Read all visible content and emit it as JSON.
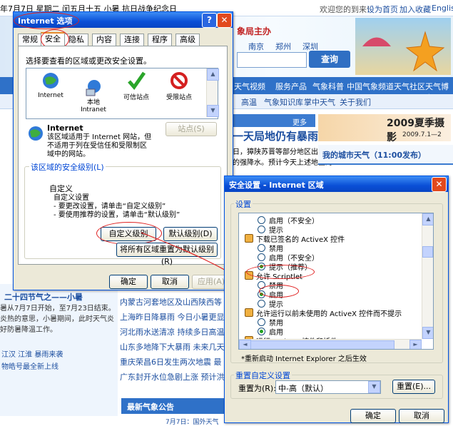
{
  "web": {
    "date_text": "年7月7日 星期二 闰五月十五 小暑 抗日战争纪念日",
    "welcome": "欢迎您的到来!",
    "set_home": "设为首页",
    "add_fav": "加入收藏",
    "english": "English",
    "header_title": "象局主办",
    "cities": [
      "南京",
      "郑州",
      "深圳"
    ],
    "search_btn": "查询",
    "nav": [
      "天气视频",
      "服务产品",
      "气象科普",
      "中国气象频道",
      "天气社区",
      "天气博客"
    ],
    "subnav": [
      "高温",
      "气象知识库",
      "掌中天气",
      "关于我们"
    ],
    "more": "更多",
    "headline": "一天局地仍有暴雨",
    "news_lines": [
      "日，獐陕苏晋等部分地区出",
      "的强降水。预计今天上述地区的"
    ],
    "my_city": "我的城市天气（11:00发布）",
    "banner_text": "2009夏季摄影",
    "banner_date": "2009.7.1—2",
    "left_title": "二十四节气之——小暑",
    "left_lines": [
      "暑从7月7日开始，至7月23日结束。",
      "炎热的意思，小暑期间，此时天气炎",
      "好防暑降温工作。"
    ],
    "left_links": [
      "江汉 江淮 暴雨来袭",
      "物皓号最全新上线"
    ],
    "list_items": [
      "内蒙古河套地区及山西陕西等",
      "上海昨日降暴雨 今日小暑更显",
      "河北雨水送清凉 持续多日高温",
      "山东多地降下大暴雨 未来几天",
      "重庆荣昌6日发生两次地震 最",
      "广东封开水位急剧上涨 预计洪"
    ],
    "bottom_title": "最新气象公告",
    "bottom_date": "7月7日：国外天气"
  },
  "inet": {
    "title": "Internet 选项",
    "tabs": [
      "常规",
      "安全",
      "隐私",
      "内容",
      "连接",
      "程序",
      "高级"
    ],
    "instruction": "选择要查看的区域或更改安全设置。",
    "zones": [
      {
        "label": "Internet",
        "icon": "globe-icon"
      },
      {
        "label": "本地\nIntranet",
        "icon": "intranet-icon"
      },
      {
        "label": "可信站点",
        "icon": "check-icon"
      },
      {
        "label": "受限站点",
        "icon": "restricted-icon"
      }
    ],
    "zone_name": "Internet",
    "zone_desc": "该区域适用于 Internet 网站，但不适用于列在受信任和受限制区域中的网站。",
    "sites_btn": "站点(S)",
    "group_label": "该区域的安全级别(L)",
    "level_title": "自定义",
    "level_lines": [
      "自定义设置",
      "- 要更改设置，请单击“自定义级别”",
      "- 要使用推荐的设置，请单击“默认级别”"
    ],
    "custom_btn": "自定义级别(C)...",
    "default_btn": "默认级别(D)",
    "reset_all_btn": "将所有区域重置为默认级别(R)",
    "ok": "确定",
    "cancel": "取消",
    "apply": "应用(A)"
  },
  "sec": {
    "title": "安全设置 - Internet 区域",
    "settings_label": "设置",
    "items": [
      {
        "kind": "radio",
        "text": "启用（不安全）",
        "on": false
      },
      {
        "kind": "radio",
        "text": "提示",
        "on": false
      },
      {
        "kind": "head",
        "text": "下载已签名的 ActiveX 控件"
      },
      {
        "kind": "radio",
        "text": "禁用",
        "on": false
      },
      {
        "kind": "radio",
        "text": "启用（不安全）",
        "on": false
      },
      {
        "kind": "radio",
        "text": "提示（推荐）",
        "on": true
      },
      {
        "kind": "head",
        "text": "允许 Scriptlet"
      },
      {
        "kind": "radio",
        "text": "禁用",
        "on": false
      },
      {
        "kind": "radio",
        "text": "启用",
        "on": true
      },
      {
        "kind": "radio",
        "text": "提示",
        "on": false
      },
      {
        "kind": "head",
        "text": "允许运行以前未使用的 ActiveX 控件而不提示"
      },
      {
        "kind": "radio",
        "text": "禁用",
        "on": false
      },
      {
        "kind": "radio",
        "text": "启用",
        "on": true
      },
      {
        "kind": "head",
        "text": "运行 ActiveX 控件和插件"
      }
    ],
    "restart_note": "*重新启动 Internet Explorer 之后生效",
    "reset_label": "重置自定义设置",
    "reset_to": "重置为(R):",
    "reset_value": "中-高（默认）",
    "reset_btn": "重置(E)...",
    "ok": "确定",
    "cancel": "取消"
  },
  "colors": {
    "title_blue": "#0a4fd6",
    "annotation_red": "#e02020",
    "xp_face": "#ece9d8"
  }
}
